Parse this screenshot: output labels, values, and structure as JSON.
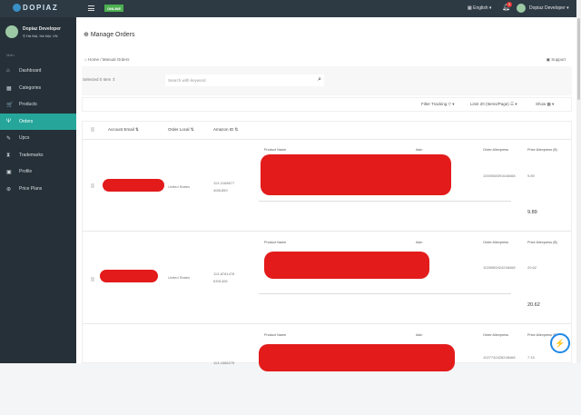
{
  "app": {
    "logo": "DOPIAZ",
    "status": "ONLINE",
    "language": "English",
    "notifications": "3",
    "user": "Dopiaz Developer"
  },
  "sidebar": {
    "user_name": "Dopiaz Developer",
    "location": "Hà Nội, Hà Nội, VN",
    "section": "Main",
    "items": [
      {
        "label": "Dashboard",
        "icon": "⌂"
      },
      {
        "label": "Categories",
        "icon": "▦"
      },
      {
        "label": "Products",
        "icon": "🛒"
      },
      {
        "label": "Orders",
        "icon": "Ψ"
      },
      {
        "label": "Upcs",
        "icon": "✎"
      },
      {
        "label": "Trademarks",
        "icon": "⧗"
      },
      {
        "label": "Profile",
        "icon": "▣"
      },
      {
        "label": "Price Plans",
        "icon": "⊛"
      }
    ]
  },
  "page": {
    "title": "Manage Orders",
    "breadcrumb_home": "Home",
    "breadcrumb_current": "Manual Orders",
    "support": "Support",
    "selected": "Selected 0 Item",
    "search_placeholder": "Search with keyword",
    "filter_tracking": "Filter Tracking",
    "limit": "Limit 20 (Items/Page)",
    "show": "Show"
  },
  "table": {
    "headers": [
      "Account Email",
      "Order Local",
      "Amazon ID"
    ],
    "sub_headers": [
      "Product Name",
      "Asin",
      "Order Aliexpress",
      "Price Aliexpress ($)"
    ],
    "rows": [
      {
        "local": "United States",
        "amazon_id_1": "113-2168677",
        "amazon_id_2": "4081859",
        "order_ali": "1000068391648468",
        "price": "9.89",
        "total": "9.89"
      },
      {
        "local": "United States",
        "amazon_id_1": "113-8781478",
        "amazon_id_2": "6391406",
        "order_ali": "1028989424248468",
        "price": "20.62",
        "total": "20.62"
      },
      {
        "local": "",
        "amazon_id_1": "113-1586275",
        "amazon_id_2": "",
        "order_ali": "1027740428248468",
        "price": "7.15",
        "total": ""
      }
    ]
  }
}
